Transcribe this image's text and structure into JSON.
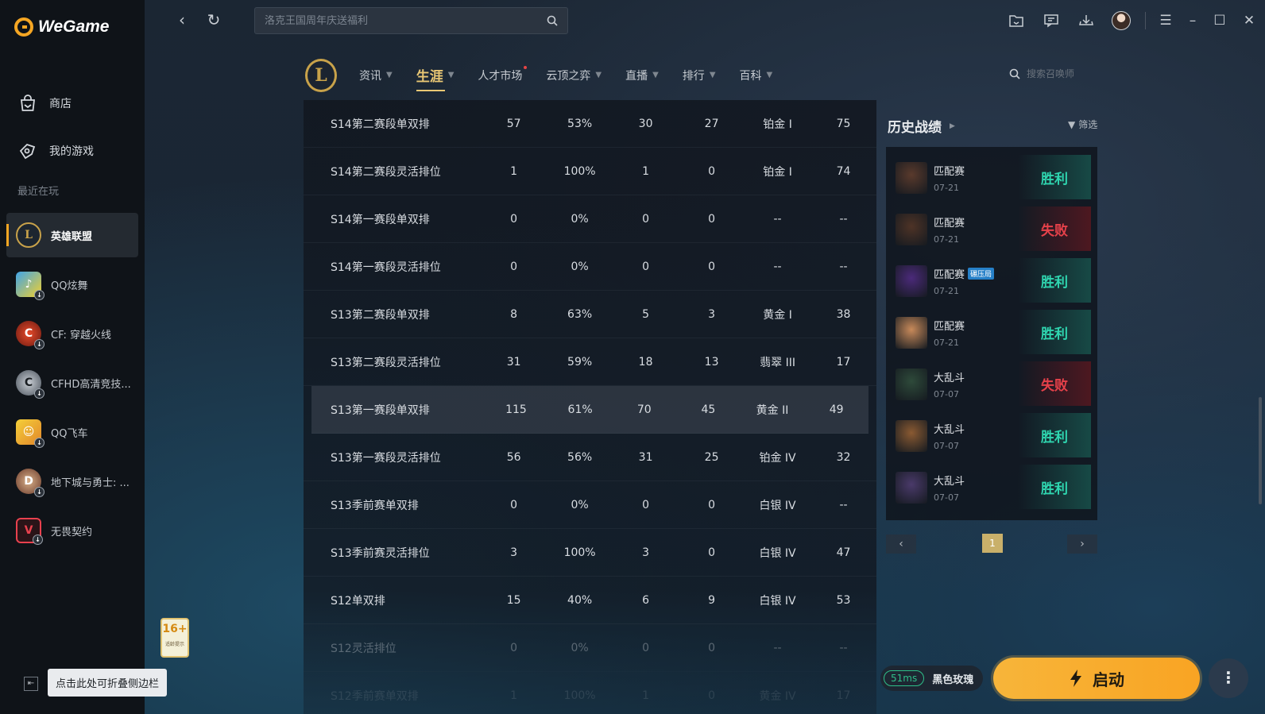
{
  "app": {
    "name": "WeGame"
  },
  "sidebar": {
    "nav": [
      {
        "label": "商店",
        "icon": "shop-bag-icon"
      },
      {
        "label": "我的游戏",
        "icon": "my-games-icon"
      }
    ],
    "recent_label": "最近在玩",
    "games": [
      {
        "label": "英雄联盟",
        "icon": "league-of-legends-icon",
        "active": true
      },
      {
        "label": "QQ炫舞",
        "icon": "qq-dance-icon"
      },
      {
        "label": "CF: 穿越火线",
        "icon": "crossfire-icon"
      },
      {
        "label": "CFHD高清竞技...",
        "icon": "cfhd-icon"
      },
      {
        "label": "QQ飞车",
        "icon": "qq-speed-icon"
      },
      {
        "label": "地下城与勇士: ...",
        "icon": "dnf-icon"
      },
      {
        "label": "无畏契约",
        "icon": "valorant-icon"
      }
    ],
    "collapse_tip": "点击此处可折叠侧边栏"
  },
  "age_rating": {
    "label": "16+",
    "sub": "适龄提示"
  },
  "titlebar": {
    "search_placeholder": "洛克王国周年庆送福利"
  },
  "game_tabs": [
    {
      "label": "资讯",
      "has_caret": true
    },
    {
      "label": "生涯",
      "has_caret": true,
      "active": true
    },
    {
      "label": "人才市场",
      "has_caret": false,
      "dot": true
    },
    {
      "label": "云顶之弈",
      "has_caret": true
    },
    {
      "label": "直播",
      "has_caret": true
    },
    {
      "label": "排行",
      "has_caret": true
    },
    {
      "label": "百科",
      "has_caret": true
    }
  ],
  "summoner_search_placeholder": "搜索召唤师",
  "seasons": [
    {
      "name": "S14第二赛段单双排",
      "games": "57",
      "winrate": "53%",
      "wins": "30",
      "losses": "27",
      "rank": "铂金 I",
      "lp": "75"
    },
    {
      "name": "S14第二赛段灵活排位",
      "games": "1",
      "winrate": "100%",
      "wins": "1",
      "losses": "0",
      "rank": "铂金 I",
      "lp": "74"
    },
    {
      "name": "S14第一赛段单双排",
      "games": "0",
      "winrate": "0%",
      "wins": "0",
      "losses": "0",
      "rank": "--",
      "lp": "--"
    },
    {
      "name": "S14第一赛段灵活排位",
      "games": "0",
      "winrate": "0%",
      "wins": "0",
      "losses": "0",
      "rank": "--",
      "lp": "--"
    },
    {
      "name": "S13第二赛段单双排",
      "games": "8",
      "winrate": "63%",
      "wins": "5",
      "losses": "3",
      "rank": "黄金 I",
      "lp": "38"
    },
    {
      "name": "S13第二赛段灵活排位",
      "games": "31",
      "winrate": "59%",
      "wins": "18",
      "losses": "13",
      "rank": "翡翠 III",
      "lp": "17"
    },
    {
      "name": "S13第一赛段单双排",
      "games": "115",
      "winrate": "61%",
      "wins": "70",
      "losses": "45",
      "rank": "黄金 II",
      "lp": "49",
      "highlight": true
    },
    {
      "name": "S13第一赛段灵活排位",
      "games": "56",
      "winrate": "56%",
      "wins": "31",
      "losses": "25",
      "rank": "铂金 IV",
      "lp": "32"
    },
    {
      "name": "S13季前赛单双排",
      "games": "0",
      "winrate": "0%",
      "wins": "0",
      "losses": "0",
      "rank": "白银 IV",
      "lp": "--"
    },
    {
      "name": "S13季前赛灵活排位",
      "games": "3",
      "winrate": "100%",
      "wins": "3",
      "losses": "0",
      "rank": "白银 IV",
      "lp": "47"
    },
    {
      "name": "S12单双排",
      "games": "15",
      "winrate": "40%",
      "wins": "6",
      "losses": "9",
      "rank": "白银 IV",
      "lp": "53"
    },
    {
      "name": "S12灵活排位",
      "games": "0",
      "winrate": "0%",
      "wins": "0",
      "losses": "0",
      "rank": "--",
      "lp": "--",
      "fade": 1
    },
    {
      "name": "S12季前赛单双排",
      "games": "1",
      "winrate": "100%",
      "wins": "1",
      "losses": "0",
      "rank": "黄金 IV",
      "lp": "17",
      "fade": 2
    }
  ],
  "history": {
    "title": "历史战绩",
    "filter_label": "筛选",
    "matches": [
      {
        "mode": "匹配赛",
        "date": "07-21",
        "result": "胜利",
        "win": true,
        "champ_color": "#5a3a2c"
      },
      {
        "mode": "匹配赛",
        "date": "07-21",
        "result": "失败",
        "win": false,
        "champ_color": "#4e3326"
      },
      {
        "mode": "匹配赛",
        "date": "07-21",
        "result": "胜利",
        "win": true,
        "tag": "碾压局",
        "champ_color": "#4b2a7a"
      },
      {
        "mode": "匹配赛",
        "date": "07-21",
        "result": "胜利",
        "win": true,
        "champ_color": "#c88a5a"
      },
      {
        "mode": "大乱斗",
        "date": "07-07",
        "result": "失败",
        "win": false,
        "champ_color": "#2e4a3a"
      },
      {
        "mode": "大乱斗",
        "date": "07-07",
        "result": "胜利",
        "win": true,
        "champ_color": "#8a5a32"
      },
      {
        "mode": "大乱斗",
        "date": "07-07",
        "result": "胜利",
        "win": true,
        "champ_color": "#4a3a6a"
      }
    ],
    "page": "1"
  },
  "launch": {
    "ping": "51ms",
    "server": "黑色玫瑰",
    "button_label": "启动"
  },
  "colors": {
    "accent": "#f5a623",
    "win": "#2fd6b0",
    "loss": "#e6414a",
    "tab_active": "#e9c774"
  }
}
